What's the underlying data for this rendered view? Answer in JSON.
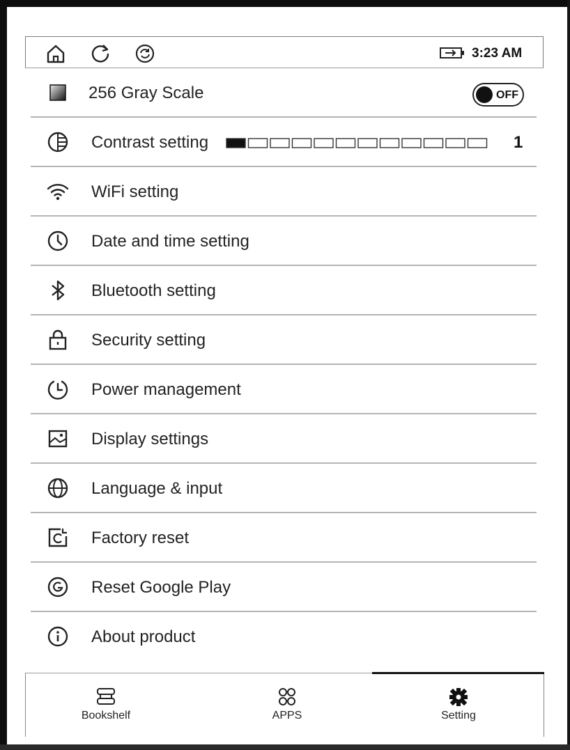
{
  "status_bar": {
    "icons": [
      "home-icon",
      "refresh-icon",
      "sync-icon"
    ],
    "battery_icon": "battery-charging-icon",
    "time": "3:23 AM"
  },
  "menu": {
    "items": [
      {
        "label": "256 Gray Scale",
        "icon": "grayscale-square-icon",
        "toggle": "OFF"
      },
      {
        "label": "Contrast setting",
        "icon": "contrast-icon",
        "level": 1,
        "max_level": 12,
        "value_text": "1"
      },
      {
        "label": "WiFi setting",
        "icon": "wifi-icon"
      },
      {
        "label": "Date and time setting",
        "icon": "clock-icon"
      },
      {
        "label": "Bluetooth setting",
        "icon": "bluetooth-icon"
      },
      {
        "label": "Security setting",
        "icon": "lock-icon"
      },
      {
        "label": "Power management",
        "icon": "power-clock-icon"
      },
      {
        "label": "Display settings",
        "icon": "display-image-icon"
      },
      {
        "label": "Language & input",
        "icon": "globe-icon"
      },
      {
        "label": "Factory reset",
        "icon": "factory-reset-icon"
      },
      {
        "label": "Reset Google Play",
        "icon": "google-icon"
      },
      {
        "label": "About product",
        "icon": "info-icon"
      }
    ]
  },
  "bottom_nav": {
    "items": [
      {
        "label": "Bookshelf",
        "icon": "bookshelf-icon",
        "active": false
      },
      {
        "label": "APPS",
        "icon": "apps-grid-icon",
        "active": false
      },
      {
        "label": "Setting",
        "icon": "gear-icon",
        "active": true
      }
    ]
  }
}
